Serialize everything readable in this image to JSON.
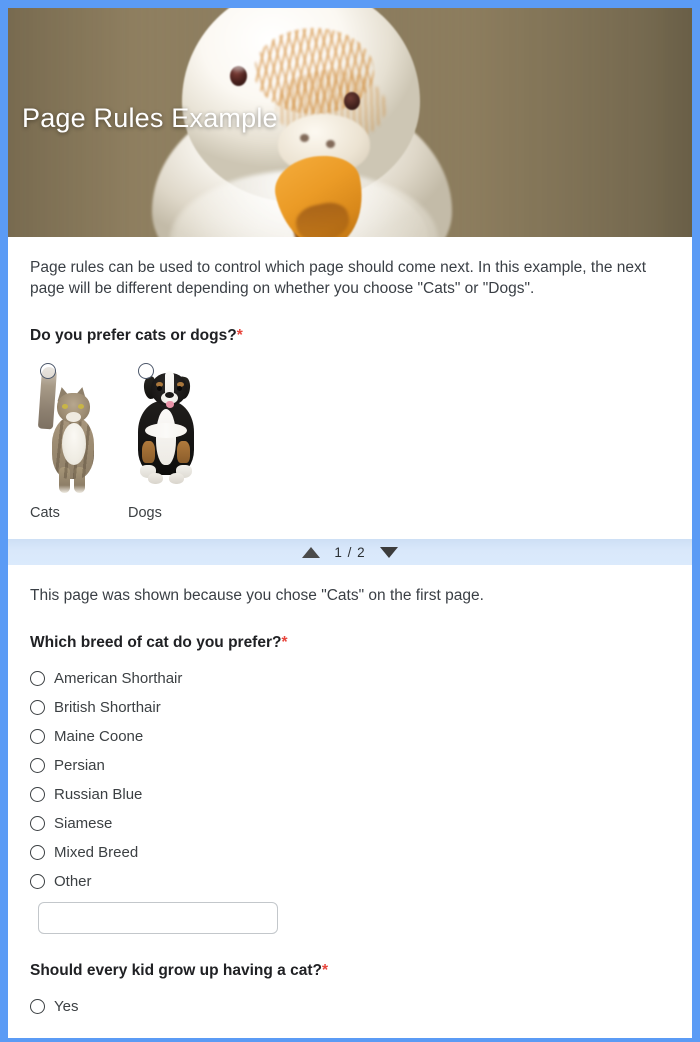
{
  "banner": {
    "title": "Page Rules Example",
    "image_alt": "white-budgie-parakeet-closeup"
  },
  "page_nav": {
    "up_icon": "triangle-up-icon",
    "down_icon": "triangle-down-icon",
    "counter": "1 / 2",
    "current_page": 1,
    "total_pages": 2
  },
  "page1": {
    "description": "Page rules can be used to control which page should come next. In this example, the next page will be different depending on whether you choose \"Cats\" or \"Dogs\".",
    "question": {
      "label": "Do you prefer cats or dogs?",
      "required_marker": "*",
      "options": [
        {
          "label": "Cats",
          "image": "tabby-cat-photo",
          "selected": false
        },
        {
          "label": "Dogs",
          "image": "bernese-mountain-dog-puppy-photo",
          "selected": false
        }
      ]
    }
  },
  "page2": {
    "description": "This page was shown because you chose \"Cats\" on the first page.",
    "question1": {
      "label": "Which breed of cat do you prefer?",
      "required_marker": "*",
      "options": [
        "American Shorthair",
        "British Shorthair",
        "Maine Coone",
        "Persian",
        "Russian Blue",
        "Siamese",
        "Mixed Breed",
        "Other"
      ],
      "other_input_value": "",
      "other_input_placeholder": ""
    },
    "question2": {
      "label": "Should every kid grow up having a cat?",
      "required_marker": "*",
      "options": [
        "Yes"
      ]
    }
  },
  "colors": {
    "frame": "#5b9bf5",
    "required": "#e8453c",
    "nav_bar": "#d9e8fb",
    "card": "#ffffff",
    "text": "#3c4043"
  }
}
